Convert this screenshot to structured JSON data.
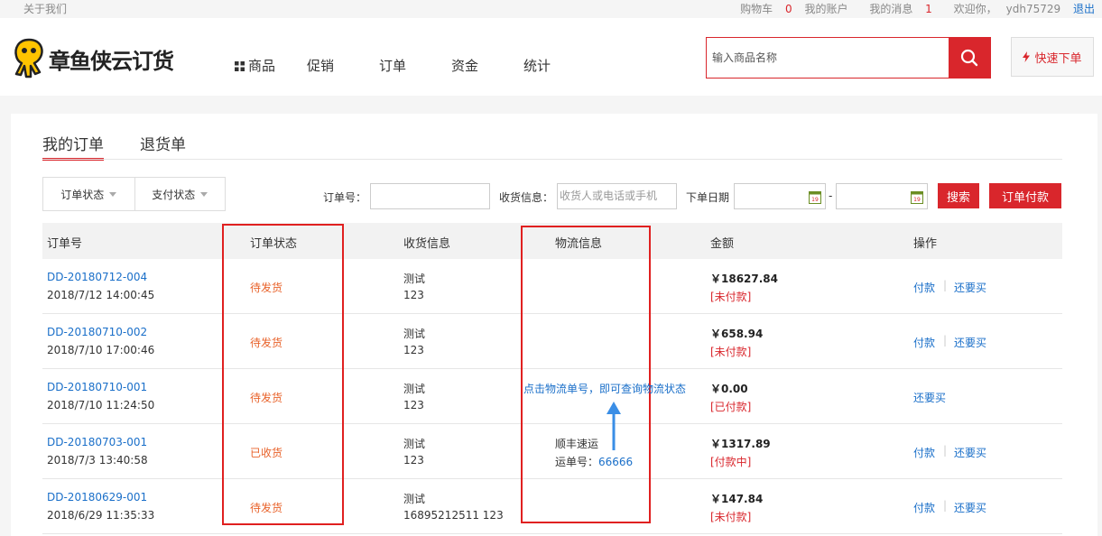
{
  "topbar": {
    "about": "关于我们",
    "cart_label": "购物车",
    "cart_count": "0",
    "account": "我的账户",
    "messages_label": "我的消息",
    "messages_count": "1",
    "welcome": "欢迎你，",
    "username": "ydh75729",
    "logout": "退出"
  },
  "header": {
    "logo_text": "章鱼侠云订货",
    "nav": [
      "商品",
      "促销",
      "订单",
      "资金",
      "统计"
    ],
    "search_placeholder": "输入商品名称",
    "quick_order": "快速下单"
  },
  "tabs": [
    "我的订单",
    "退货单"
  ],
  "filters": {
    "order_status": "订单状态",
    "pay_status": "支付状态",
    "order_no_label": "订单号：",
    "receiver_label": "收货信息：",
    "receiver_placeholder": "收货人或电话或手机",
    "date_label": "下单日期",
    "date_sep": "-",
    "search_btn": "搜索",
    "pay_btn": "订单付款"
  },
  "table": {
    "headers": [
      "订单号",
      "订单状态",
      "收货信息",
      "物流信息",
      "金额",
      "操作"
    ],
    "rows": [
      {
        "order_no": "DD-20180712-004",
        "time": "2018/7/12 14:00:45",
        "status": "待发货",
        "name": "测试",
        "addr": "123",
        "logistics": "",
        "tracking_label": "",
        "tracking_no": "",
        "amount": "￥18627.84",
        "pay_state": "[未付款]",
        "actions": [
          "付款",
          "还要买"
        ]
      },
      {
        "order_no": "DD-20180710-002",
        "time": "2018/7/10 17:00:46",
        "status": "待发货",
        "name": "测试",
        "addr": "123",
        "logistics": "",
        "tracking_label": "",
        "tracking_no": "",
        "amount": "￥658.94",
        "pay_state": "[未付款]",
        "actions": [
          "付款",
          "还要买"
        ]
      },
      {
        "order_no": "DD-20180710-001",
        "time": "2018/7/10 11:24:50",
        "status": "待发货",
        "name": "测试",
        "addr": "123",
        "logistics": "",
        "tracking_label": "",
        "tracking_no": "",
        "amount": "￥0.00",
        "pay_state": "[已付款]",
        "actions": [
          "还要买"
        ]
      },
      {
        "order_no": "DD-20180703-001",
        "time": "2018/7/3 13:40:58",
        "status": "已收货",
        "name": "测试",
        "addr": "123",
        "logistics": "顺丰速运",
        "tracking_label": "运单号：",
        "tracking_no": "66666",
        "amount": "￥1317.89",
        "pay_state": "[付款中]",
        "actions": [
          "付款",
          "还要买"
        ]
      },
      {
        "order_no": "DD-20180629-001",
        "time": "2018/6/29 11:35:33",
        "status": "待发货",
        "name": "测试",
        "addr": "16895212511 123",
        "logistics": "",
        "tracking_label": "",
        "tracking_no": "",
        "amount": "￥147.84",
        "pay_state": "[未付款]",
        "actions": [
          "付款",
          "还要买"
        ]
      }
    ]
  },
  "annotation": {
    "tip": "点击物流单号，即可查询物流状态"
  },
  "colors": {
    "brand_red": "#d9262c",
    "link_blue": "#1a6fc9",
    "status_orange": "#e8622a"
  }
}
